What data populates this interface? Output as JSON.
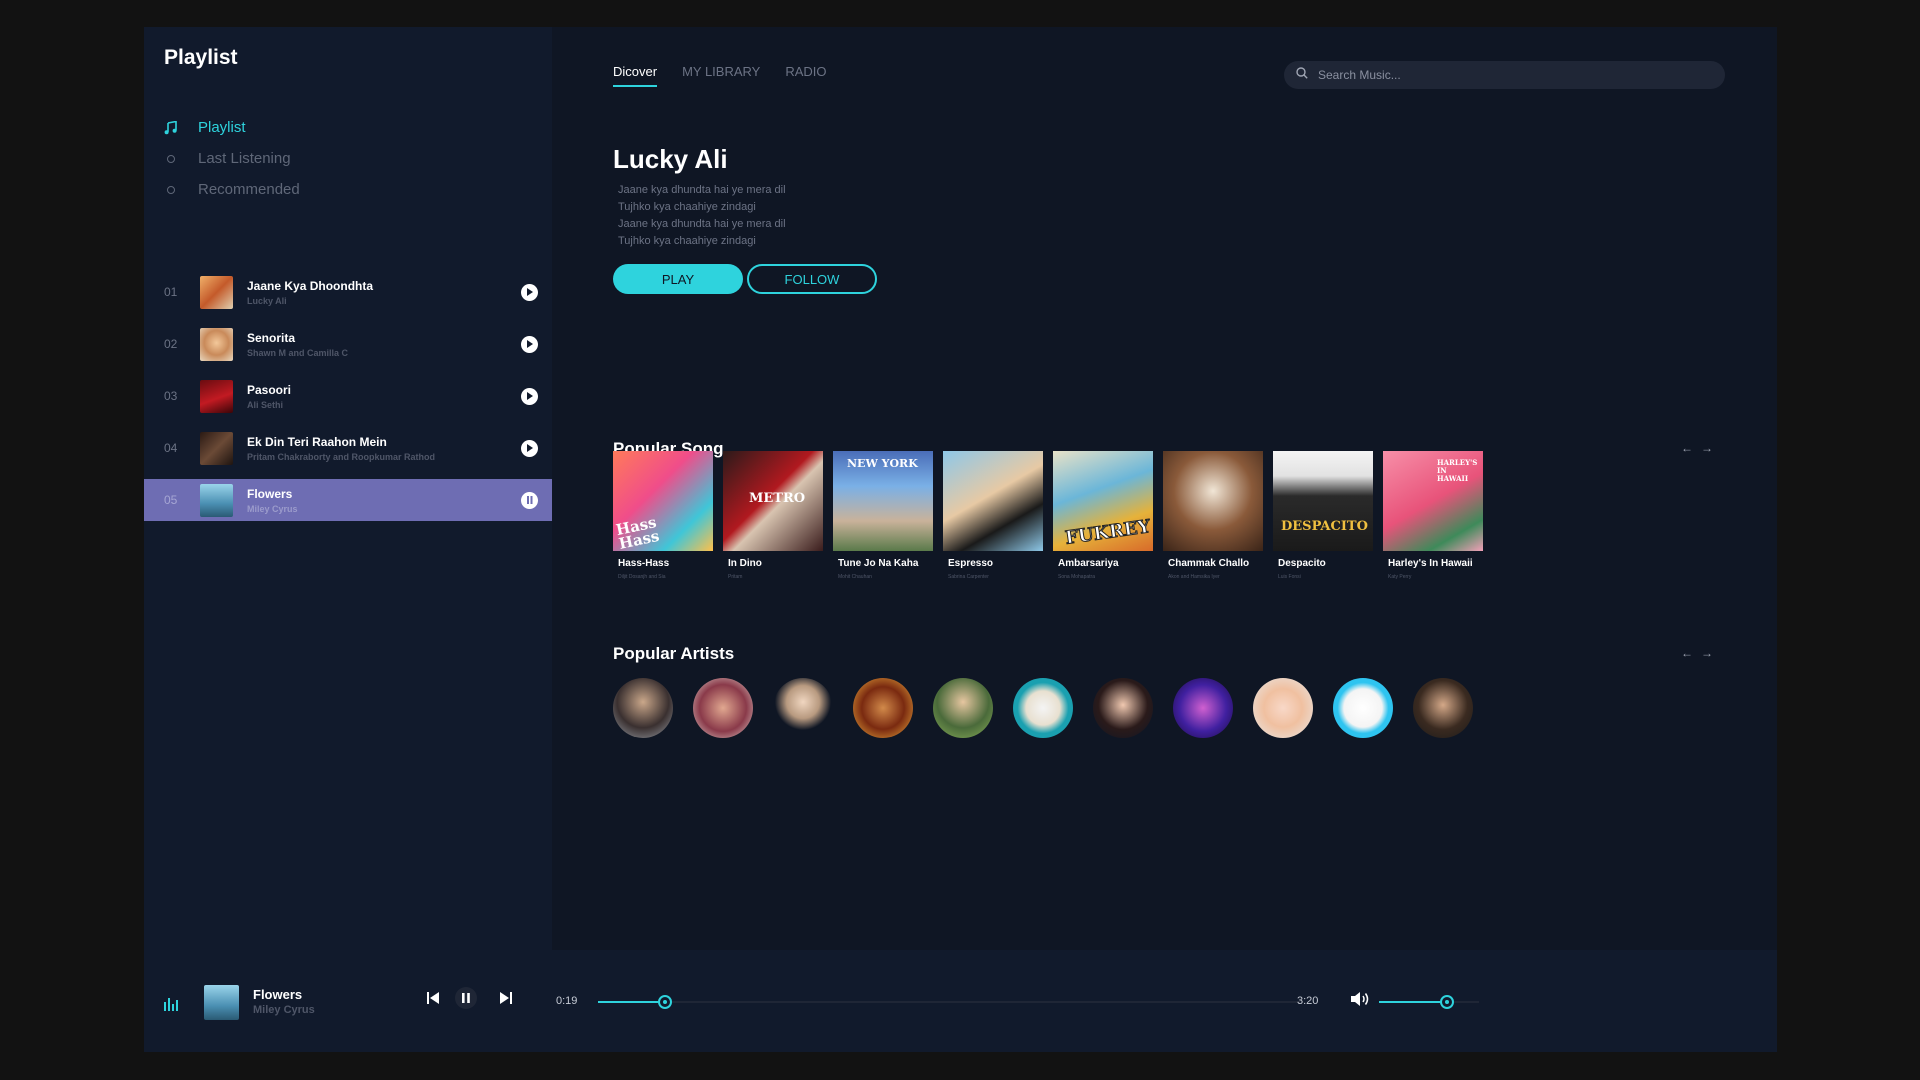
{
  "sidebar": {
    "title": "Playlist",
    "nav": [
      {
        "label": "Playlist",
        "icon": "music-note-icon",
        "active": true
      },
      {
        "label": "Last Listening",
        "icon": "circle-icon",
        "active": false
      },
      {
        "label": "Recommended",
        "icon": "circle-icon",
        "active": false
      }
    ],
    "tracks": [
      {
        "num": "01",
        "title": "Jaane Kya Dhoondhta",
        "artist": "Lucky Ali",
        "active": false
      },
      {
        "num": "02",
        "title": "Senorita",
        "artist": "Shawn M and Camilla C",
        "active": false
      },
      {
        "num": "03",
        "title": "Pasoori",
        "artist": "Ali Sethi",
        "active": false
      },
      {
        "num": "04",
        "title": "Ek Din Teri Raahon Mein",
        "artist": "Pritam Chakraborty and Roopkumar Rathod",
        "active": false
      },
      {
        "num": "05",
        "title": "Flowers",
        "artist": "Miley Cyrus",
        "active": true
      }
    ]
  },
  "main": {
    "tabs": [
      {
        "label": "Dicover",
        "active": true
      },
      {
        "label": "MY LIBRARY",
        "active": false
      },
      {
        "label": "RADIO",
        "active": false
      }
    ],
    "search": {
      "placeholder": "Search Music..."
    },
    "featured": {
      "artist": "Lucky Ali",
      "lyrics": [
        "Jaane kya dhundta hai ye mera dil",
        "Tujhko kya chaahiye zindagi",
        "Jaane kya dhundta hai ye mera dil",
        "Tujhko kya chaahiye zindagi"
      ],
      "play_label": "PLAY",
      "follow_label": "FOLLOW"
    },
    "popular_songs": {
      "title": "Popular Song",
      "items": [
        {
          "title": "Hass-Hass",
          "artist": "Diljit Dosanjh and Sia"
        },
        {
          "title": "In Dino",
          "artist": "Pritam"
        },
        {
          "title": "Tune Jo Na Kaha",
          "artist": "Mohit Chauhan"
        },
        {
          "title": "Espresso",
          "artist": "Sabrina Carpenter"
        },
        {
          "title": "Ambarsariya",
          "artist": "Sona Mohapatra"
        },
        {
          "title": "Chammak Challo",
          "artist": "Akon and Hamsika Iyer"
        },
        {
          "title": "Despacito",
          "artist": "Luis Fonsi"
        },
        {
          "title": "Harley's In Hawaii",
          "artist": "Katy Perry"
        }
      ]
    },
    "popular_artists": {
      "title": "Popular Artists",
      "count": 11
    },
    "cover_text": {
      "hass": "Hass Hass",
      "metro": "METRO",
      "newyork": "NEW YORK",
      "fukrey": "FUKREY",
      "despacito": "DESPACITO",
      "harley": "HARLEY'S IN HAWAII"
    }
  },
  "player": {
    "title": "Flowers",
    "artist": "Miley Cyrus",
    "elapsed": "0:19",
    "duration": "3:20",
    "progress": 0.095,
    "volume": 0.68
  },
  "colors": {
    "accent": "#2ed3dd",
    "active_track": "#6e6db3",
    "background": "#0f1624",
    "sidebar": "#111a2c"
  }
}
